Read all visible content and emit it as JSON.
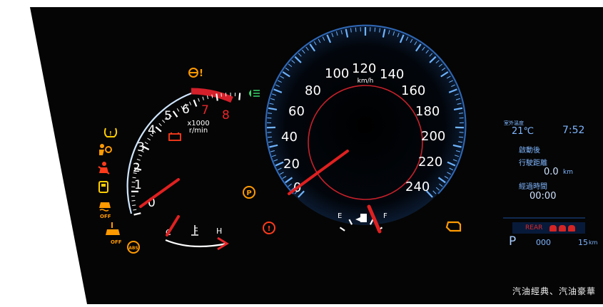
{
  "tachometer": {
    "ticks": [
      "0",
      "1",
      "2",
      "3",
      "4",
      "5",
      "6",
      "7",
      "8"
    ],
    "unit_line1": "x1000",
    "unit_line2": "r/min"
  },
  "speedometer": {
    "ticks": [
      "20",
      "40",
      "60",
      "80",
      "100",
      "120",
      "140",
      "160",
      "180",
      "200",
      "220",
      "240"
    ],
    "zero_label": "0",
    "unit": "km/h"
  },
  "temp_gauge": {
    "cold_label": "C",
    "hot_label": "H"
  },
  "fuel_gauge": {
    "empty_label": "E",
    "full_label": "F"
  },
  "warning_lights": {
    "abs_text": "ABS",
    "parking_text": "P",
    "off_text_1": "OFF",
    "off_text_2": "OFF"
  },
  "info_display": {
    "outside_temp_label": "室外溫度",
    "outside_temp_value": "21℃",
    "clock": "7:52",
    "since_start_label": "啟動後",
    "distance_label": "行駛距離",
    "distance_value": "0.0",
    "distance_unit": "km",
    "elapsed_label": "經過時間",
    "elapsed_value": "00:00",
    "rear_label": "REAR",
    "gear": "P",
    "odometer": "000",
    "trip_value": "15",
    "trip_unit": "km"
  },
  "caption": "汽油經典、汽油豪華",
  "colors": {
    "background": "#050505",
    "tick_blue": "#6fb4ff",
    "redline": "#e8262a",
    "needle": "#e02020",
    "warning_amber": "#ff9a00",
    "warning_red": "#ff3b1c",
    "indicator_green": "#36d66b",
    "lcd_blue": "#7fb6ff"
  }
}
